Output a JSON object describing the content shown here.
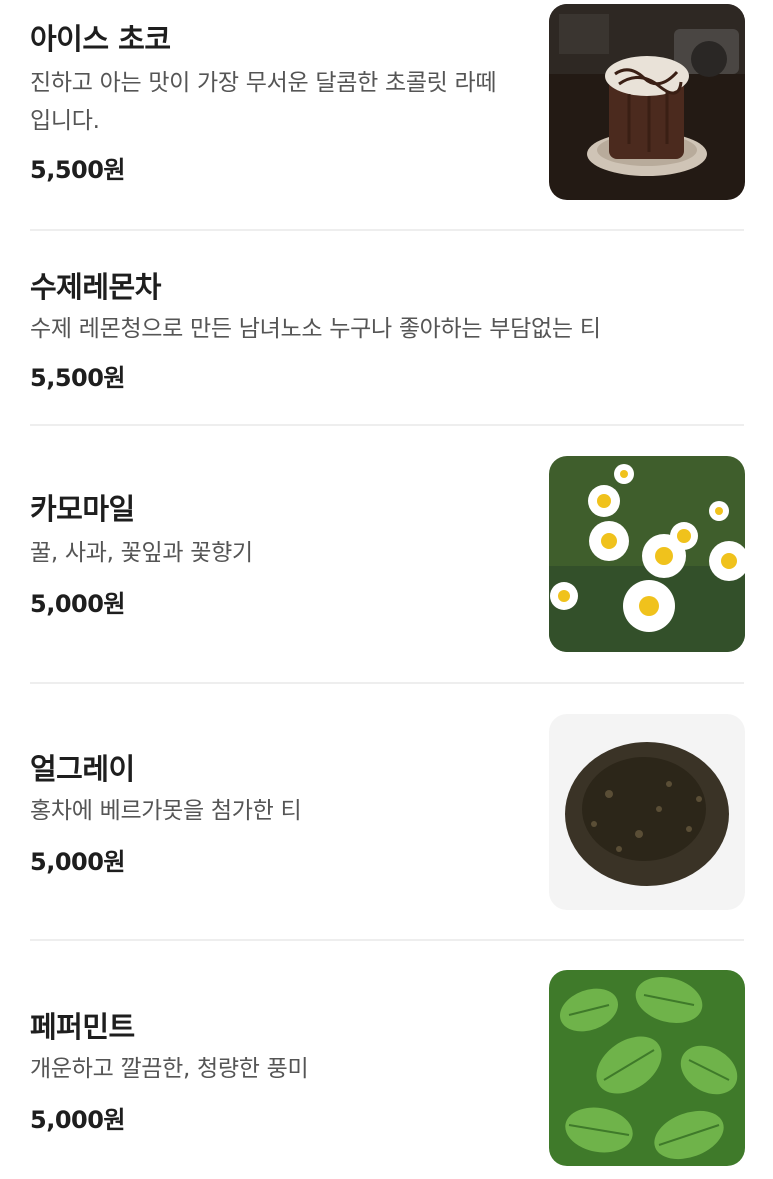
{
  "items": [
    {
      "name": "아이스 초코",
      "description": "진하고 아는 맛이 가장 무서운 달콤한 초콜릿 라떼 입니다.",
      "price": "5,500원",
      "image": "iced-chocolate-photo"
    },
    {
      "name": "수제레몬차",
      "description": "수제 레몬청으로 만든 남녀노소 누구나 좋아하는 부담없는 티",
      "price": "5,500원"
    },
    {
      "name": "카모마일",
      "description": "꿀, 사과, 꽃잎과 꽃향기",
      "price": "5,000원",
      "image": "chamomile-flowers-photo"
    },
    {
      "name": "얼그레이",
      "description": "홍차에 베르가못을 첨가한 티",
      "price": "5,000원",
      "image": "earl-grey-tea-leaves-photo"
    },
    {
      "name": "페퍼민트",
      "description": "개운하고 깔끔한, 청량한 풍미",
      "price": "5,000원",
      "image": "peppermint-leaves-photo"
    }
  ]
}
